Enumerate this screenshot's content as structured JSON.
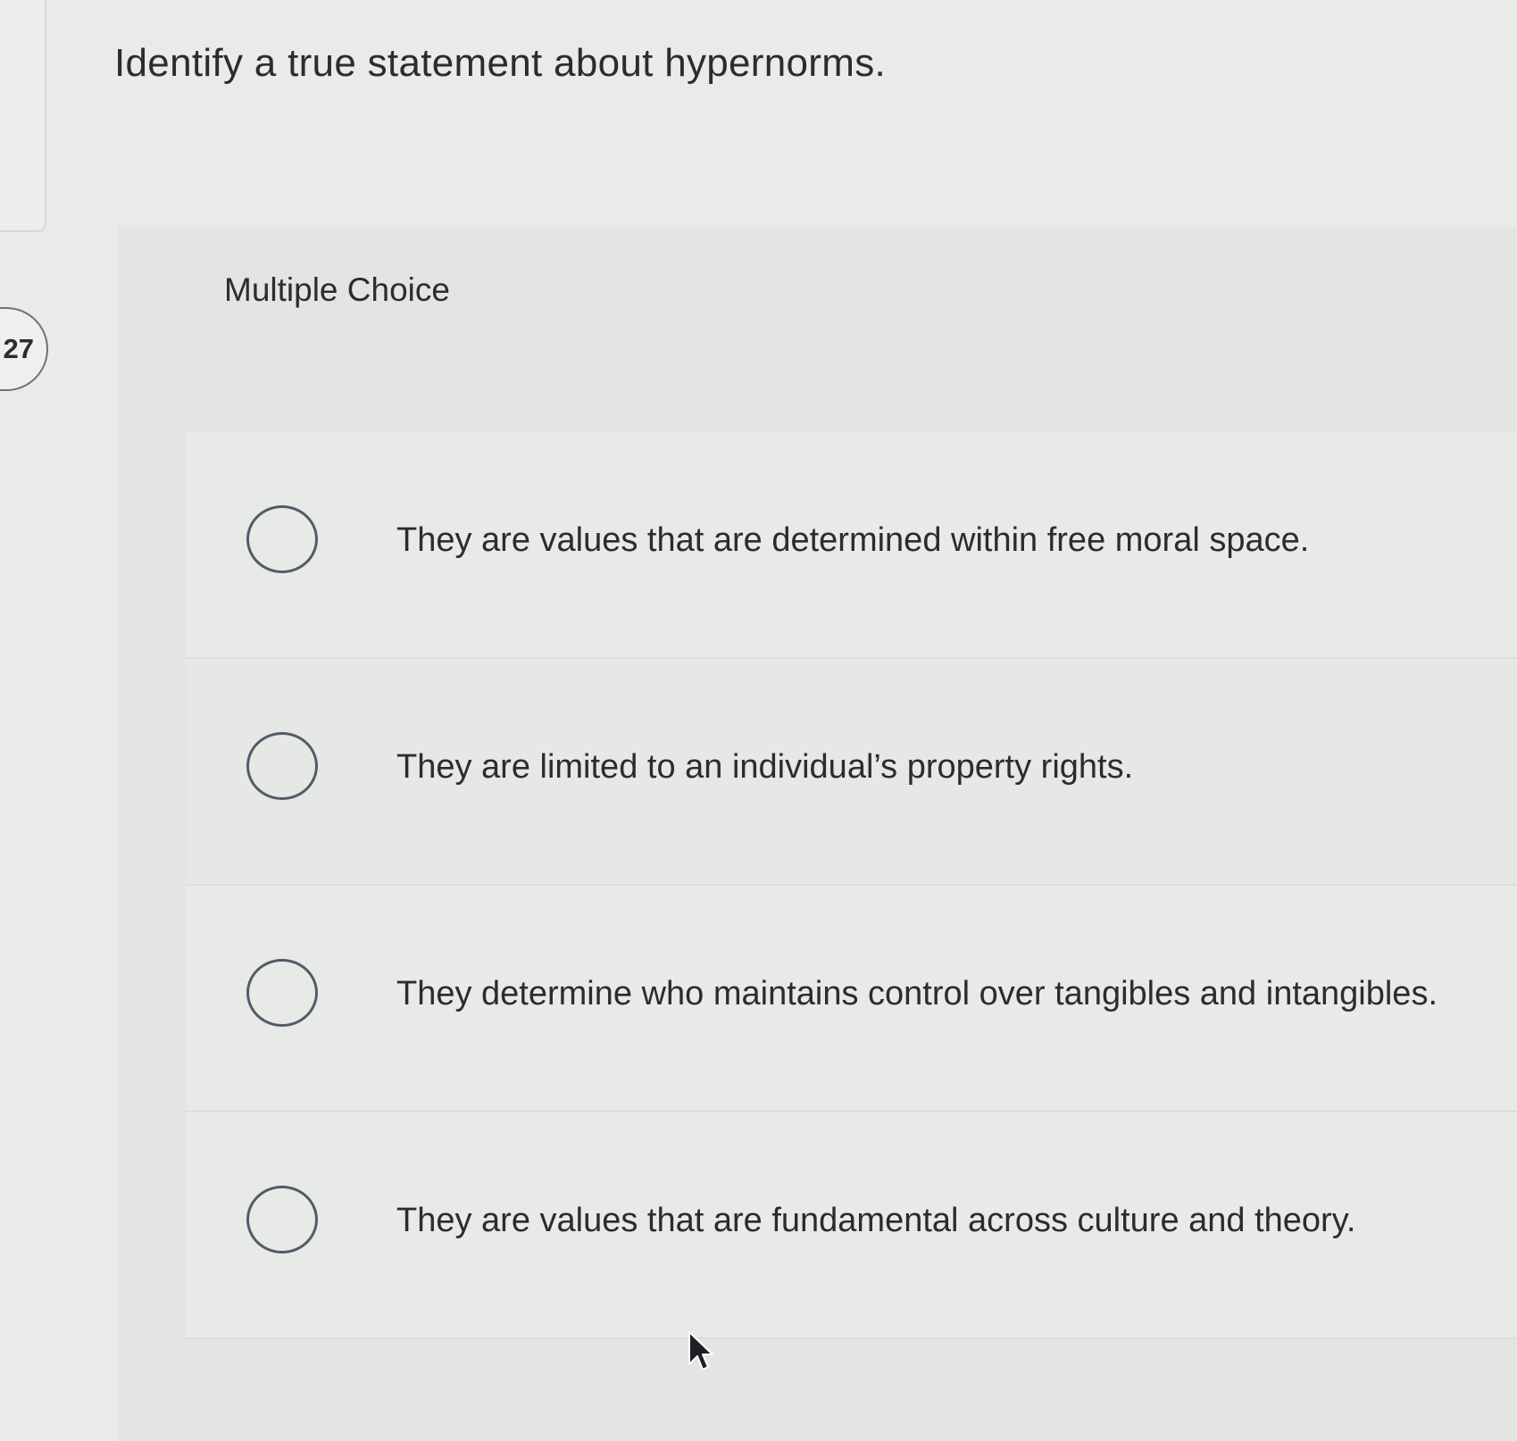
{
  "question": {
    "number": "27",
    "prompt": "Identify a true statement about hypernorms.",
    "type_label": "Multiple Choice",
    "options": [
      {
        "label": "They are values that are determined within free moral space.",
        "selected": false
      },
      {
        "label": "They are limited to an individual’s property rights.",
        "selected": false
      },
      {
        "label": "They determine who maintains control over tangibles and intangibles.",
        "selected": false
      },
      {
        "label": "They are values that are fundamental across culture and theory.",
        "selected": false
      }
    ]
  },
  "icons": {
    "radio": "radio-unchecked-icon",
    "cursor": "mouse-pointer-icon"
  }
}
